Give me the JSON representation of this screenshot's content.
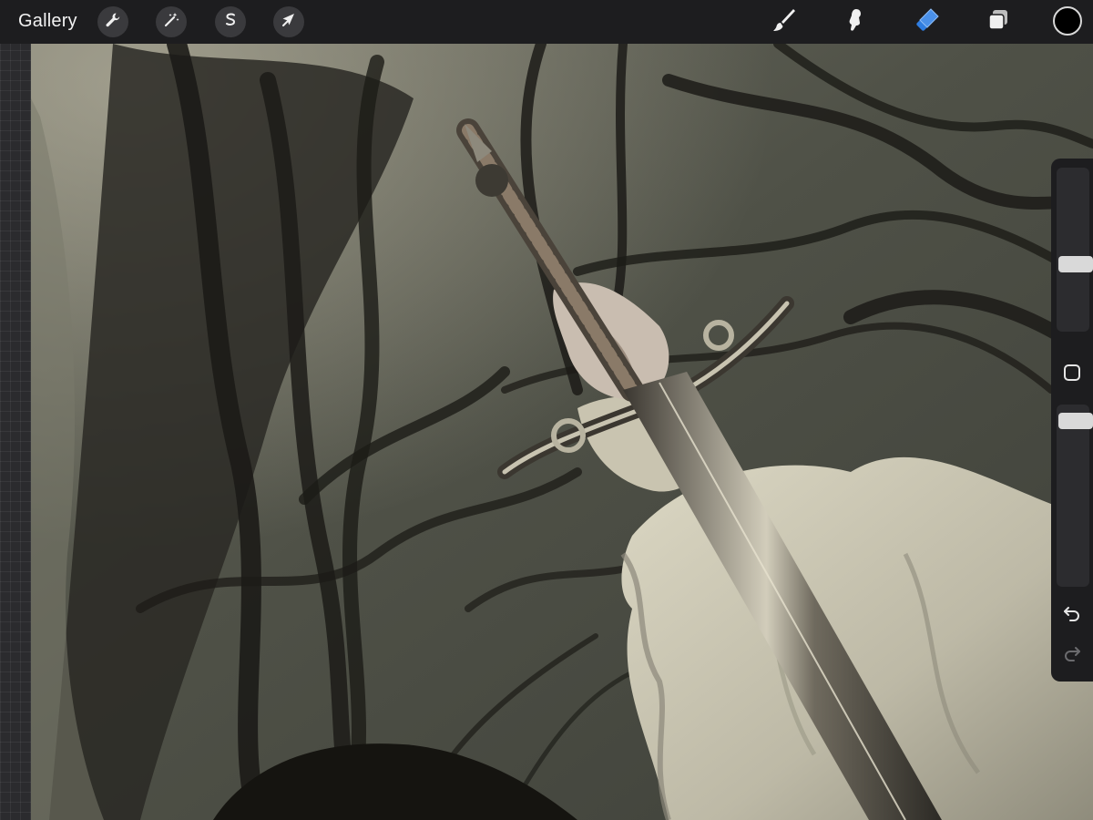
{
  "toolbar": {
    "gallery_label": "Gallery",
    "left_tools": [
      {
        "icon": "wrench-icon",
        "name": "actions"
      },
      {
        "icon": "magic-wand-icon",
        "name": "adjustments"
      },
      {
        "icon": "selection-s-icon",
        "name": "selection"
      },
      {
        "icon": "arrow-cursor-icon",
        "name": "transform"
      }
    ],
    "right_tools": [
      {
        "icon": "brush-icon",
        "name": "paint"
      },
      {
        "icon": "smudge-icon",
        "name": "smudge"
      },
      {
        "icon": "eraser-icon",
        "name": "erase"
      },
      {
        "icon": "layers-icon",
        "name": "layers"
      }
    ],
    "active_tool": "erase",
    "active_color": "#2f7de0",
    "current_color": "#000000"
  },
  "sidebar": {
    "brush_size": 0.4,
    "opacity": 0.95,
    "modify_icon": "square-icon",
    "undo_icon": "undo-icon",
    "redo_icon": "redo-icon",
    "redo_enabled": false
  },
  "canvas": {
    "palette": {
      "background": "#55574c",
      "dark_fronds": "#1e1c18",
      "sleeve": "#cfcbb8",
      "blade": "#a8a392",
      "skin": "#c9bdb0"
    }
  }
}
